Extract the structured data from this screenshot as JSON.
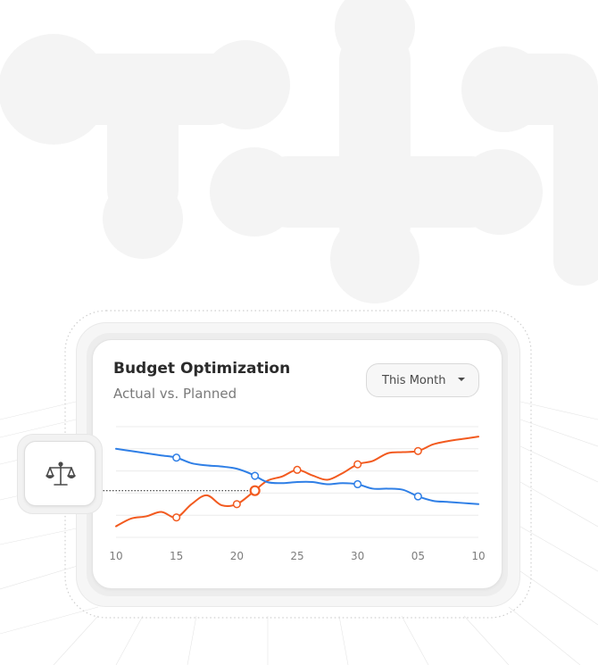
{
  "card": {
    "title": "Budget Optimization",
    "subtitle": "Actual vs. Planned"
  },
  "period_select": {
    "selected": "This Month"
  },
  "side_badge": {
    "icon": "scale-icon"
  },
  "colors": {
    "actual": "#f25a1f",
    "planned": "#2f7fe6",
    "grid": "#ececec",
    "axis_text": "#7d7d7d"
  },
  "chart_data": {
    "type": "line",
    "categories": [
      "10",
      "15",
      "20",
      "25",
      "30",
      "05",
      "10"
    ],
    "x_index": [
      0,
      0.25,
      0.5,
      0.75,
      1,
      1.25,
      1.5,
      1.75,
      2,
      2.25,
      2.5,
      2.75,
      3,
      3.25,
      3.5,
      3.75,
      4,
      4.25,
      4.5,
      4.75,
      5,
      5.25,
      5.5,
      5.75,
      6
    ],
    "series": [
      {
        "color": "#f25a1f",
        "values": [
          1.0,
          1.7,
          1.9,
          2.3,
          1.8,
          3.0,
          3.8,
          2.9,
          3.0,
          4.0,
          5.1,
          5.5,
          6.1,
          5.6,
          5.2,
          5.8,
          6.6,
          6.9,
          7.6,
          7.7,
          7.8,
          8.4,
          8.7,
          8.9,
          9.1
        ],
        "markers_at": [
          1,
          2,
          2.3,
          3,
          4,
          5
        ]
      },
      {
        "color": "#2f7fe6",
        "values": [
          8.0,
          7.8,
          7.6,
          7.4,
          7.2,
          6.7,
          6.5,
          6.4,
          6.2,
          5.7,
          5.0,
          4.9,
          5.0,
          5.0,
          4.8,
          4.9,
          4.8,
          4.4,
          4.4,
          4.3,
          3.7,
          3.3,
          3.2,
          3.1,
          3.0
        ],
        "markers_at": [
          1,
          2.3,
          4,
          5
        ]
      }
    ],
    "x_ticks": [
      "10",
      "15",
      "20",
      "25",
      "30",
      "05",
      "10"
    ],
    "ylim": [
      0,
      10
    ],
    "grid": "horizontal",
    "legend": "none",
    "crosshair_at": 2.3
  }
}
